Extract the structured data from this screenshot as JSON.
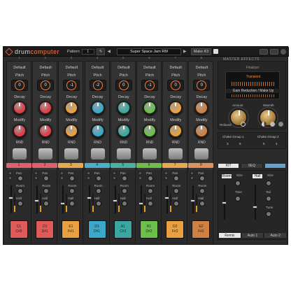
{
  "header": {
    "logo_drum": "drum",
    "logo_computer": "computer",
    "pattern_label": "Pattern",
    "pattern_value": "1",
    "preset_name": "Super Space Jam RM",
    "make_button": "Make K3",
    "master_effects": "MASTER EFFECTS"
  },
  "channel_numbers": [
    "1",
    "2",
    "3",
    "4",
    "5",
    "6",
    "7",
    "8"
  ],
  "voices": [
    {
      "name": "Default",
      "pitch": "0",
      "color": "#e0404a",
      "instrument": "drum-icon"
    },
    {
      "name": "Default",
      "pitch": "0",
      "color": "#e0404a",
      "instrument": "snare-icon"
    },
    {
      "name": "Default",
      "pitch": "-1",
      "color": "#e8a040",
      "instrument": "hihat-icon"
    },
    {
      "name": "Default",
      "pitch": "-2",
      "color": "#3aa8c8",
      "instrument": "hand-icon"
    },
    {
      "name": "Default",
      "pitch": "0",
      "color": "#3aa8a0",
      "instrument": "bongo-icon"
    },
    {
      "name": "Default",
      "pitch": "-1",
      "color": "#6cc04a",
      "instrument": "cymbal-icon"
    },
    {
      "name": "Default",
      "pitch": "0",
      "color": "#e8a040",
      "instrument": "clap-icon"
    },
    {
      "name": "Default",
      "pitch": "0",
      "color": "#d08040",
      "instrument": "dice-icon"
    }
  ],
  "labels": {
    "pitch": "Pitch",
    "decay": "Decay",
    "modify": "Modify",
    "rnd": "RND",
    "pan": "Pan",
    "room": "Room",
    "hall": "Hall",
    "size": "Size",
    "time": "Time",
    "tune": "Tune",
    "tail": "Tail"
  },
  "tabs": [
    {
      "label": "1",
      "color": "#e06070"
    },
    {
      "label": "2",
      "color": "#e06070"
    },
    {
      "label": "3",
      "color": "#e8a850"
    },
    {
      "label": "4",
      "color": "#4ab0c8"
    },
    {
      "label": "5",
      "color": "#4ab0a0"
    },
    {
      "label": "6",
      "color": "#6cc04a"
    },
    {
      "label": "7",
      "color": "#e8a850"
    },
    {
      "label": "8",
      "color": "#e0905a"
    }
  ],
  "pads": [
    {
      "top": "C1",
      "bottom": "C#0",
      "color": "#e05a5a"
    },
    {
      "top": "D1",
      "bottom": "D#1",
      "color": "#e05a5a"
    },
    {
      "top": "E1",
      "bottom": "F#1",
      "color": "#e8a040"
    },
    {
      "top": "D1",
      "bottom": "D#1",
      "color": "#3aa8c8"
    },
    {
      "top": "A1",
      "bottom": "C#2",
      "color": "#3aa8a0"
    },
    {
      "top": "R1",
      "bottom": "D#2",
      "color": "#6cc04a"
    },
    {
      "top": "D2",
      "bottom": "F#2",
      "color": "#e8a040"
    },
    {
      "top": "E2",
      "bottom": "F#2",
      "color": "#d08040"
    }
  ],
  "finalizer": {
    "title": "Finalizer",
    "items": [
      "Transient",
      "Gain Reduction / Make Up"
    ],
    "amount": "Amount",
    "warmth": "Warmth",
    "relaxed": "Relaxed"
  },
  "choke": {
    "group1": "Choke Group 1",
    "group2": "Choke Group 2",
    "g1a": "3",
    "g1b": "6",
    "g2a": "5",
    "g2b": "4"
  },
  "kit_buttons": [
    "KIT",
    "SEQ",
    ""
  ],
  "fx_tabs": {
    "room": "Room",
    "hall": "Hall"
  },
  "remix": [
    "Remix",
    "Auto 1",
    "Auto 2"
  ]
}
